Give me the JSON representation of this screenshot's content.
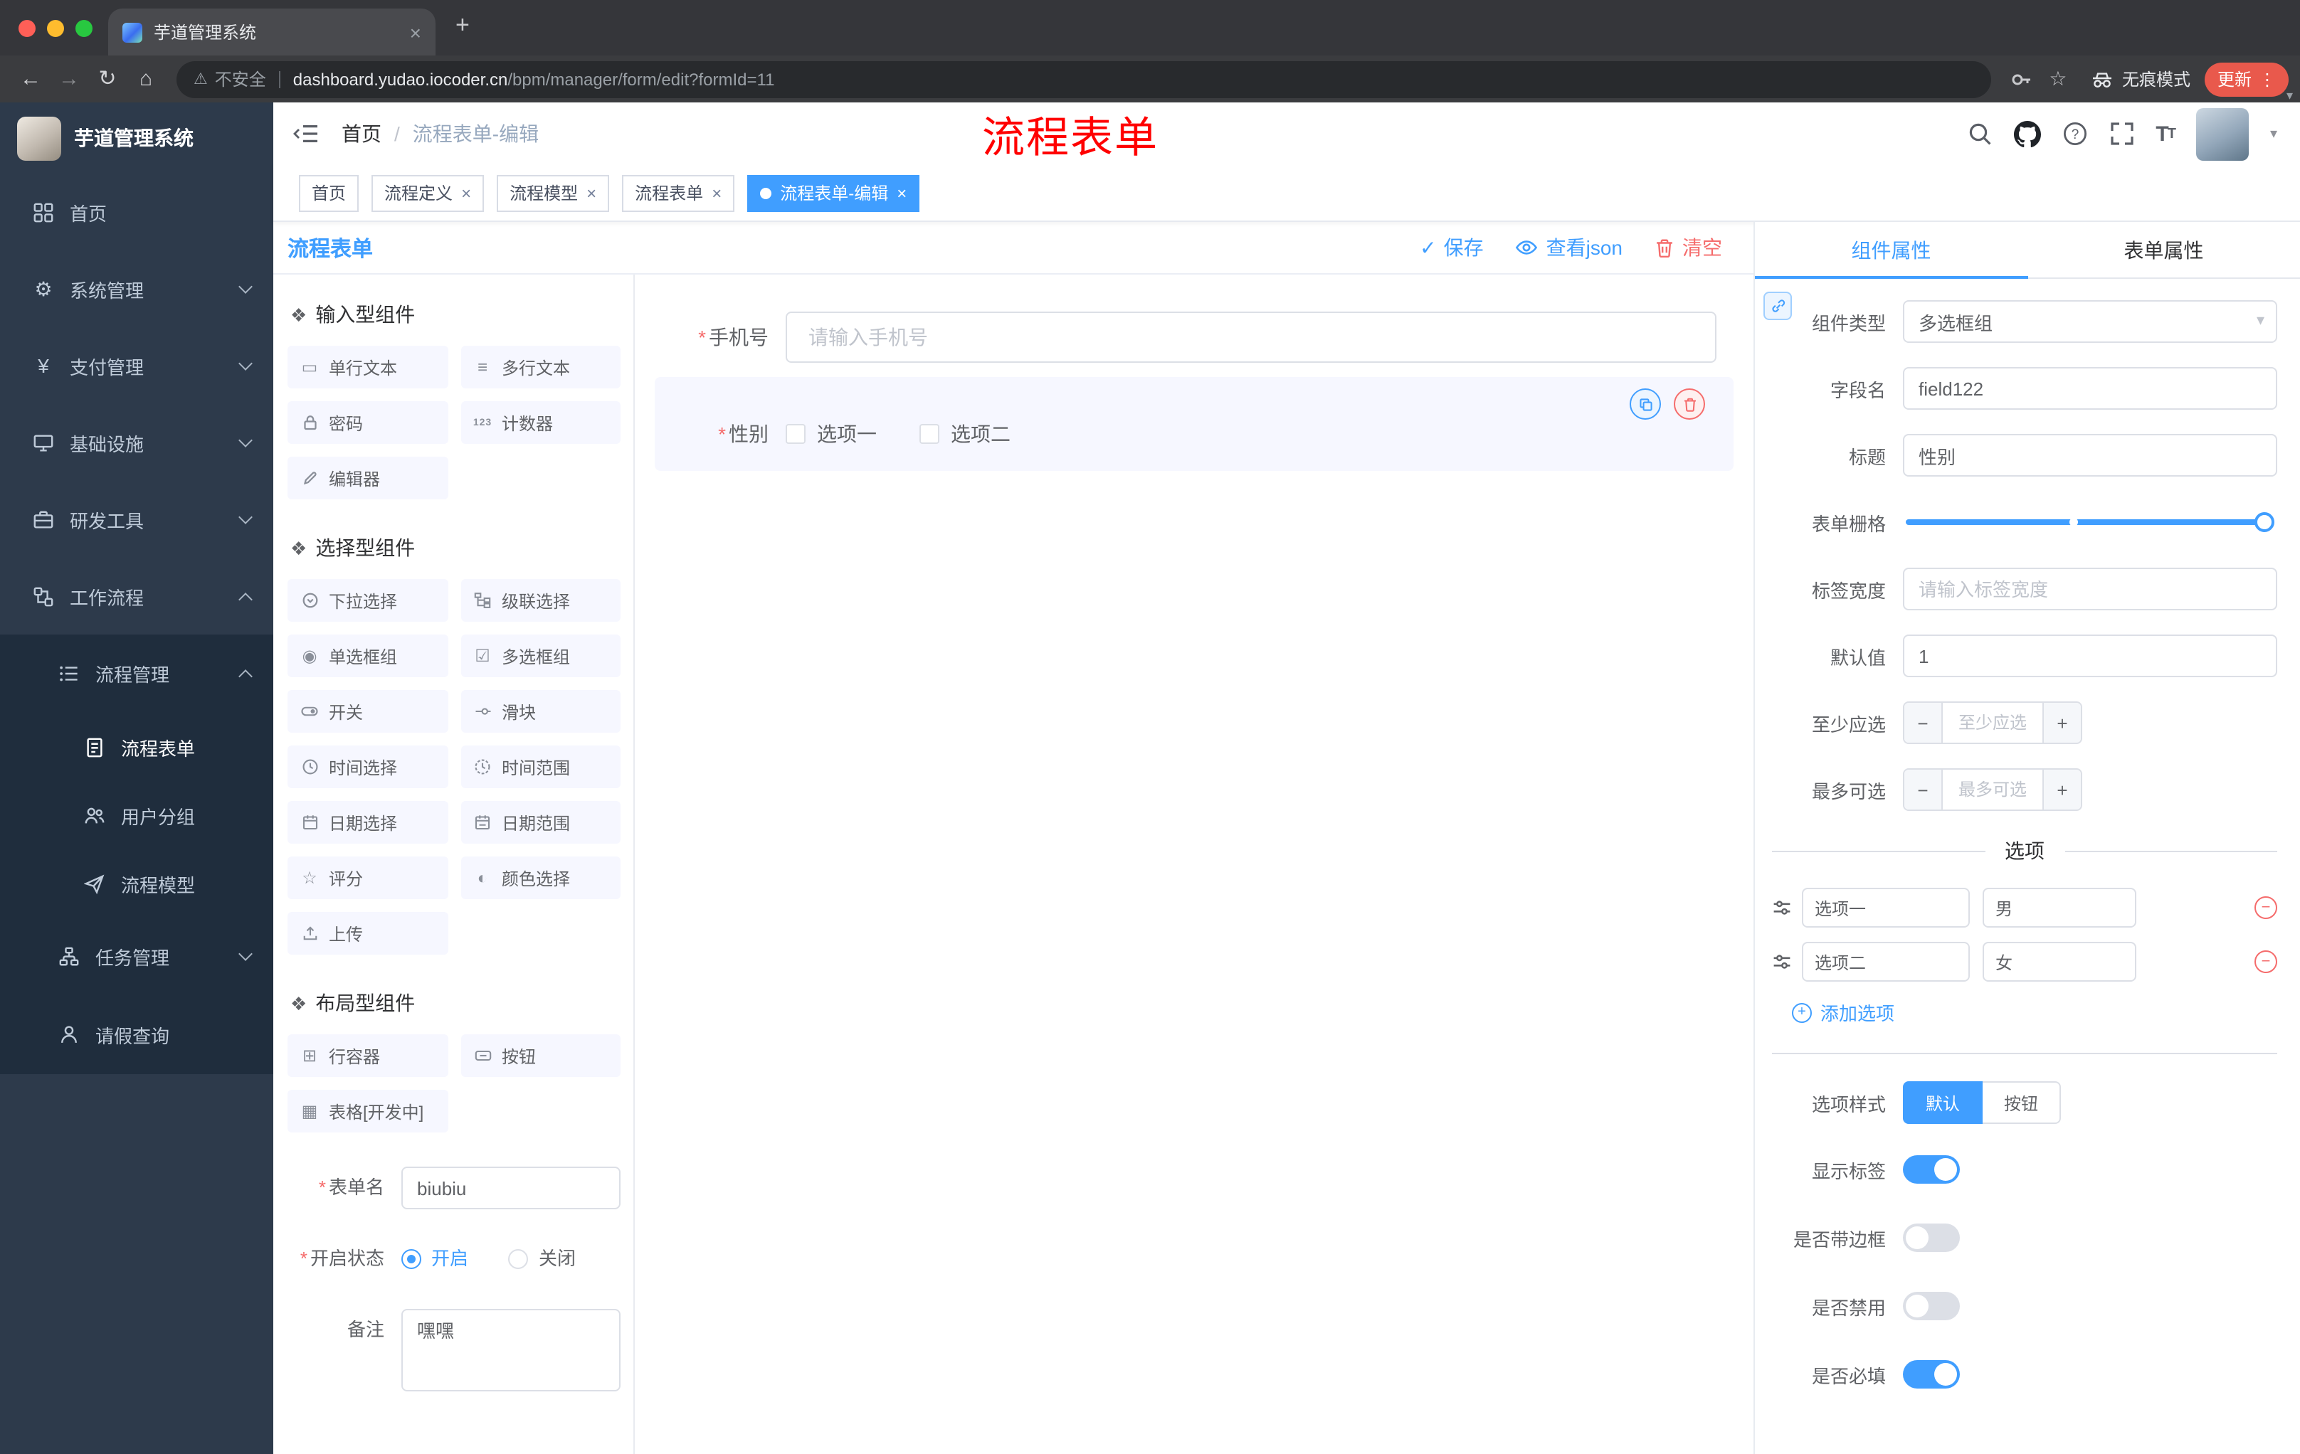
{
  "browser": {
    "tab_title": "芋道管理系统",
    "security_label": "不安全",
    "url_domain": "dashboard.yudao.iocoder.cn",
    "url_path": "/bpm/manager/form/edit?formId=11",
    "incognito_label": "无痕模式",
    "update_label": "更新"
  },
  "icons": {
    "close": "×",
    "plus": "+",
    "back": "←",
    "forward": "→",
    "reload": "↻",
    "home": "⌂",
    "warning": "⚠",
    "star": "☆",
    "more": "⋮",
    "caret": "▾",
    "slash": "/",
    "minus": "−",
    "check": "✓",
    "asterisk": "*",
    "question": "?",
    "gear": "⚙",
    "yen": "¥",
    "single_text": "▭",
    "multi_text": "≡",
    "radio": "◉",
    "checkbox": "☑",
    "star_rate": "☆",
    "color": "◐",
    "row_container": "⊞",
    "table": "▦",
    "section": "❖",
    "num": "123"
  },
  "sidebar": {
    "title": "芋道管理系统",
    "items": [
      {
        "label": "首页"
      },
      {
        "label": "系统管理"
      },
      {
        "label": "支付管理"
      },
      {
        "label": "基础设施"
      },
      {
        "label": "研发工具"
      },
      {
        "label": "工作流程"
      },
      {
        "label": "流程管理"
      },
      {
        "label": "流程表单"
      },
      {
        "label": "用户分组"
      },
      {
        "label": "流程模型"
      },
      {
        "label": "任务管理"
      },
      {
        "label": "请假查询"
      }
    ]
  },
  "header": {
    "breadcrumb_home": "首页",
    "breadcrumb_current": "流程表单-编辑",
    "annotation": "流程表单"
  },
  "tags": [
    {
      "label": "首页"
    },
    {
      "label": "流程定义"
    },
    {
      "label": "流程模型"
    },
    {
      "label": "流程表单"
    },
    {
      "label": "流程表单-编辑"
    }
  ],
  "workspace": {
    "title": "流程表单",
    "save": "保存",
    "view_json": "查看json",
    "clear": "清空"
  },
  "palette": {
    "section_input": "输入型组件",
    "section_select": "选择型组件",
    "section_layout": "布局型组件",
    "items_input": [
      "单行文本",
      "多行文本",
      "密码",
      "计数器",
      "编辑器"
    ],
    "items_select": [
      "下拉选择",
      "级联选择",
      "单选框组",
      "多选框组",
      "开关",
      "滑块",
      "时间选择",
      "时间范围",
      "日期选择",
      "日期范围",
      "评分",
      "颜色选择",
      "上传"
    ],
    "items_layout": [
      "行容器",
      "按钮",
      "表格[开发中]"
    ]
  },
  "meta_form": {
    "name_label": "表单名",
    "name_value": "biubiu",
    "status_label": "开启状态",
    "status_on": "开启",
    "status_off": "关闭",
    "remark_label": "备注",
    "remark_value": "嘿嘿"
  },
  "canvas": {
    "phone_label": "手机号",
    "phone_placeholder": "请输入手机号",
    "gender_label": "性别",
    "gender_opt1": "选项一",
    "gender_opt2": "选项二"
  },
  "props": {
    "tab_component": "组件属性",
    "tab_form": "表单属性",
    "type_label": "组件类型",
    "type_value": "多选框组",
    "field_label": "字段名",
    "field_value": "field122",
    "title_label": "标题",
    "title_value": "性别",
    "grid_label": "表单栅格",
    "width_label": "标签宽度",
    "width_placeholder": "请输入标签宽度",
    "default_label": "默认值",
    "default_value": "1",
    "min_label": "至少应选",
    "min_placeholder": "至少应选",
    "max_label": "最多可选",
    "max_placeholder": "最多可选",
    "options_title": "选项",
    "option1_label": "选项一",
    "option1_value": "男",
    "option2_label": "选项二",
    "option2_value": "女",
    "add_option": "添加选项",
    "style_label": "选项样式",
    "style_default": "默认",
    "style_button": "按钮",
    "switch_show_label": "显示标签",
    "switch_border": "是否带边框",
    "switch_disabled": "是否禁用",
    "switch_required": "是否必填"
  },
  "colors": {
    "accent": "#409eff",
    "danger": "#f56c6c",
    "annotation": "#ff0000",
    "sidebar_bg": "#2d3a4b",
    "sidebar_sub_bg": "#1f2d3d"
  }
}
